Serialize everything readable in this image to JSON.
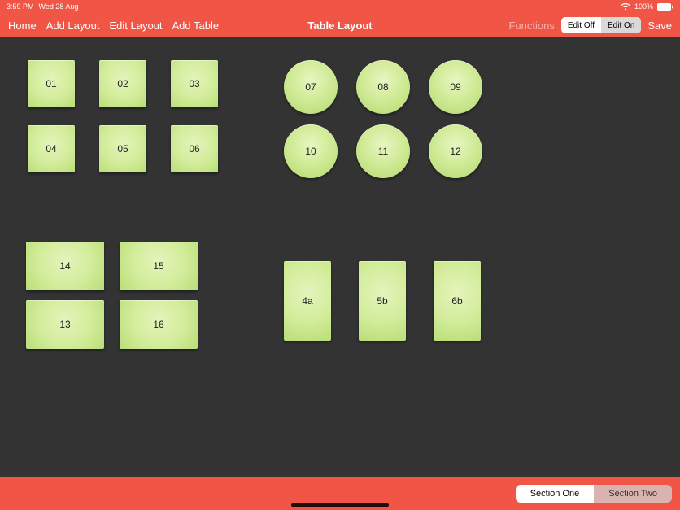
{
  "status": {
    "time": "3:59 PM",
    "date": "Wed 28 Aug",
    "battery_pct": "100%"
  },
  "nav": {
    "home": "Home",
    "add_layout": "Add Layout",
    "edit_layout": "Edit Layout",
    "add_table": "Add Table",
    "title": "Table Layout",
    "functions": "Functions",
    "edit_off": "Edit Off",
    "edit_on": "Edit On",
    "save": "Save"
  },
  "tables": {
    "t01": "01",
    "t02": "02",
    "t03": "03",
    "t04": "04",
    "t05": "05",
    "t06": "06",
    "t07": "07",
    "t08": "08",
    "t09": "09",
    "t10": "10",
    "t11": "11",
    "t12": "12",
    "t13": "13",
    "t14": "14",
    "t15": "15",
    "t16": "16",
    "t4a": "4a",
    "t5b": "5b",
    "t6b": "6b"
  },
  "sections": {
    "one": "Section One",
    "two": "Section Two"
  }
}
